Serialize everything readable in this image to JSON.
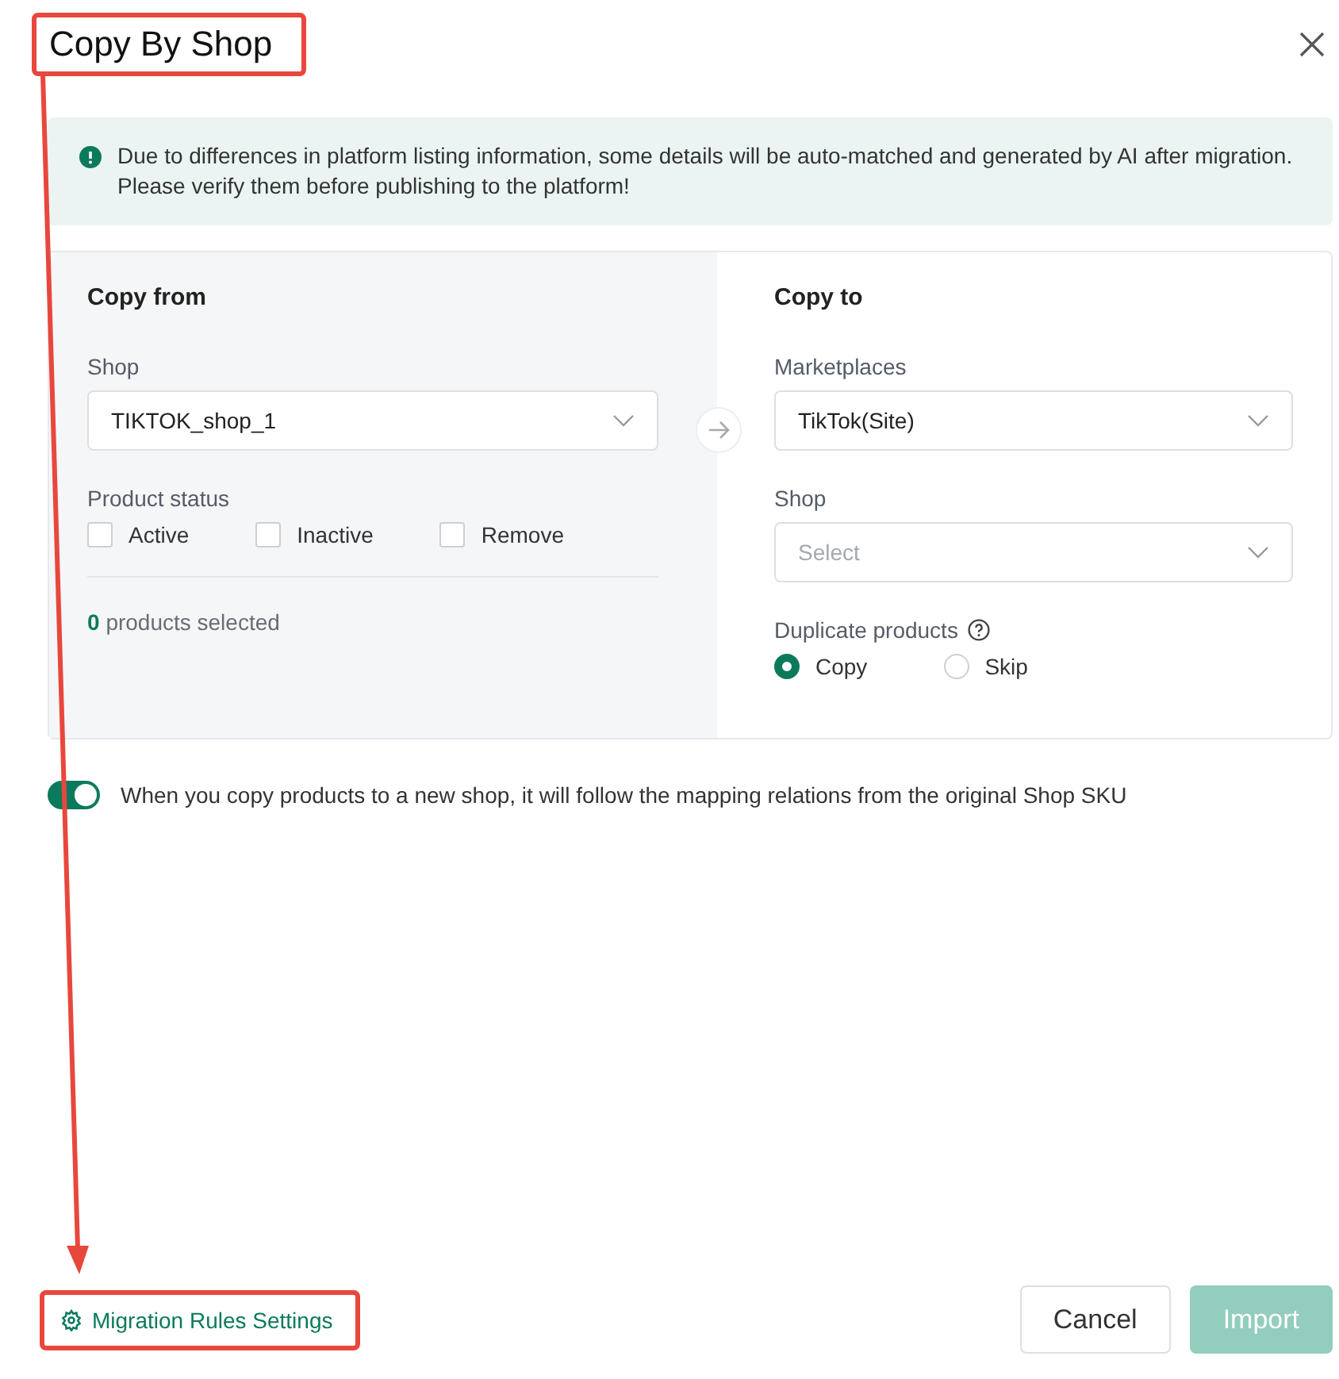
{
  "dialog": {
    "title": "Copy By Shop"
  },
  "alert": {
    "text": "Due to differences in platform listing information, some details will be auto-matched and generated by AI after migration. Please verify them before publishing to the platform!"
  },
  "copy_from": {
    "heading": "Copy from",
    "shop_label": "Shop",
    "shop_value": "TIKTOK_shop_1",
    "status_label": "Product status",
    "statuses": [
      {
        "label": "Active",
        "checked": false
      },
      {
        "label": "Inactive",
        "checked": false
      },
      {
        "label": "Remove",
        "checked": false
      }
    ],
    "selected_count": "0",
    "selected_text": "products selected"
  },
  "copy_to": {
    "heading": "Copy to",
    "marketplaces_label": "Marketplaces",
    "marketplaces_value": "TikTok(Site)",
    "shop_label": "Shop",
    "shop_placeholder": "Select",
    "duplicate_label": "Duplicate products",
    "duplicate_options": [
      {
        "label": "Copy",
        "selected": true
      },
      {
        "label": "Skip",
        "selected": false
      }
    ]
  },
  "mapping_toggle": {
    "on": true,
    "text": "When you copy products to a new shop, it will follow the mapping relations from the original Shop SKU"
  },
  "footer": {
    "link": "Migration Rules Settings",
    "buttons": [
      {
        "label": "Cancel",
        "kind": "secondary",
        "disabled": false
      },
      {
        "label": "Import",
        "kind": "primary",
        "disabled": true
      }
    ]
  }
}
